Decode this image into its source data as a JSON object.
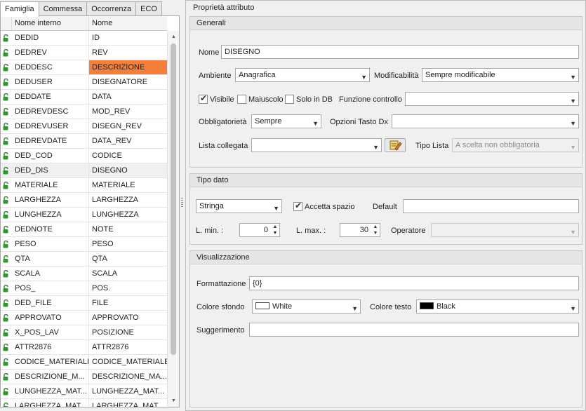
{
  "tabs": [
    {
      "label": "Famiglia"
    },
    {
      "label": "Commessa"
    },
    {
      "label": "Occorrenza"
    },
    {
      "label": "ECO"
    }
  ],
  "grid": {
    "headers": {
      "internal": "Nome interno",
      "name": "Nome"
    },
    "rows": [
      {
        "internal": "DEDID",
        "name": "ID"
      },
      {
        "internal": "DEDREV",
        "name": "REV"
      },
      {
        "internal": "DEDDESC",
        "name": "DESCRIZIONE"
      },
      {
        "internal": "DEDUSER",
        "name": "DISEGNATORE"
      },
      {
        "internal": "DEDDATE",
        "name": "DATA"
      },
      {
        "internal": "DEDREVDESC",
        "name": "MOD_REV"
      },
      {
        "internal": "DEDREVUSER",
        "name": "DISEGN_REV"
      },
      {
        "internal": "DEDREVDATE",
        "name": "DATA_REV"
      },
      {
        "internal": "DED_COD",
        "name": "CODICE"
      },
      {
        "internal": "DED_DIS",
        "name": "DISEGNO"
      },
      {
        "internal": "MATERIALE",
        "name": "MATERIALE"
      },
      {
        "internal": "LARGHEZZA",
        "name": "LARGHEZZA"
      },
      {
        "internal": "LUNGHEZZA",
        "name": "LUNGHEZZA"
      },
      {
        "internal": "DEDNOTE",
        "name": "NOTE"
      },
      {
        "internal": "PESO",
        "name": "PESO"
      },
      {
        "internal": "QTA",
        "name": "QTA"
      },
      {
        "internal": "SCALA",
        "name": "SCALA"
      },
      {
        "internal": "POS_",
        "name": "POS."
      },
      {
        "internal": "DED_FILE",
        "name": "FILE"
      },
      {
        "internal": "APPROVATO",
        "name": "APPROVATO"
      },
      {
        "internal": "X_POS_LAV",
        "name": "POSIZIONE"
      },
      {
        "internal": "ATTR2876",
        "name": "ATTR2876"
      },
      {
        "internal": "CODICE_MATERIALE",
        "name": "CODICE_MATERIALE"
      },
      {
        "internal": "DESCRIZIONE_M...",
        "name": "DESCRIZIONE_MA..."
      },
      {
        "internal": "LUNGHEZZA_MAT...",
        "name": "LUNGHEZZA_MAT..."
      },
      {
        "internal": "LARGHEZZA_MAT...",
        "name": "LARGHEZZA_MAT..."
      }
    ],
    "selected_row": "DEDDESC",
    "highlight_row": "DED_DIS"
  },
  "panel": {
    "title": "Proprietà attributo",
    "generali": {
      "title": "Generali",
      "nome_label": "Nome",
      "nome_value": "DISEGNO",
      "ambiente_label": "Ambiente",
      "ambiente_value": "Anagrafica",
      "modificabilita_label": "Modificabilità",
      "modificabilita_value": "Sempre modificabile",
      "visibile_label": "Visibile",
      "maiuscolo_label": "Maiuscolo",
      "solo_db_label": "Solo in DB",
      "funzione_label": "Funzione controllo",
      "funzione_value": "",
      "obbligatorieta_label": "Obbligatorietà",
      "obbligatorieta_value": "Sempre",
      "opzioni_label": "Opzioni Tasto Dx",
      "opzioni_value": "",
      "lista_label": "Lista collegata",
      "lista_value": "",
      "tipo_lista_label": "Tipo Lista",
      "tipo_lista_value": "A scelta non obbligatoria"
    },
    "tipo_dato": {
      "title": "Tipo dato",
      "tipo_value": "Stringa",
      "accetta_label": "Accetta spazio",
      "default_label": "Default",
      "default_value": "",
      "lmin_label": "L. min. :",
      "lmin_value": "0",
      "lmax_label": "L. max. :",
      "lmax_value": "30",
      "operatore_label": "Operatore",
      "operatore_value": ""
    },
    "visualizzazione": {
      "title": "Visualizzazione",
      "formattazione_label": "Formattazione",
      "formattazione_value": "{0}",
      "sfondo_label": "Colore sfondo",
      "sfondo_value": "White",
      "testo_label": "Colore testo",
      "testo_value": "Black",
      "suggerimento_label": "Suggerimento",
      "suggerimento_value": ""
    }
  },
  "colors": {
    "selection": "#f47f3a",
    "lock": "#2e9a2e",
    "sfondo_swatch": "#ffffff",
    "testo_swatch": "#000000"
  }
}
